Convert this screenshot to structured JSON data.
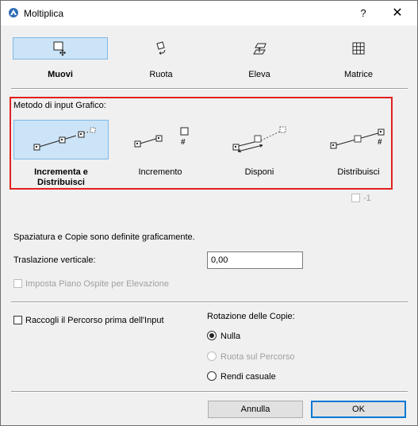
{
  "window": {
    "title": "Moltiplica",
    "help_label": "?",
    "close_label": "✕",
    "app_icon": "archicad-icon"
  },
  "modes": [
    {
      "label": "Muovi",
      "icon": "move-icon",
      "selected": true
    },
    {
      "label": "Ruota",
      "icon": "rotate-icon",
      "selected": false
    },
    {
      "label": "Eleva",
      "icon": "elevate-icon",
      "selected": false
    },
    {
      "label": "Matrice",
      "icon": "matrix-icon",
      "selected": false
    }
  ],
  "input_method": {
    "title": "Metodo di input Grafico:",
    "options": [
      {
        "label": "Incrementa e Distribuisci",
        "icon": "increment-distribute-icon",
        "selected": true
      },
      {
        "label": "Incremento",
        "icon": "increment-icon",
        "selected": false
      },
      {
        "label": "Disponi",
        "icon": "arrange-icon",
        "selected": false
      },
      {
        "label": "Distribuisci",
        "icon": "distribute-icon",
        "selected": false
      }
    ],
    "minus_one_label": "-1",
    "minus_one_checked": false
  },
  "info_text": "Spaziatura e Copie sono definite graficamente.",
  "vertical_offset": {
    "label": "Traslazione verticale:",
    "value": "0,00"
  },
  "host_floor": {
    "label": "Imposta Piano Ospite per Elevazione",
    "checked": false,
    "enabled": false
  },
  "collect_path": {
    "label": "Raccogli il Percorso prima dell'Input",
    "checked": false
  },
  "rotation": {
    "title": "Rotazione delle Copie:",
    "options": [
      {
        "label": "Nulla",
        "selected": true,
        "enabled": true
      },
      {
        "label": "Ruota sul Percorso",
        "selected": false,
        "enabled": false
      },
      {
        "label": "Rendi casuale",
        "selected": false,
        "enabled": true
      }
    ]
  },
  "buttons": {
    "cancel": "Annulla",
    "ok": "OK"
  },
  "colors": {
    "selected_fill": "#cce4f7",
    "selected_border": "#7fb8e6",
    "highlight_border": "#e02020",
    "default_button_border": "#0078d7"
  }
}
